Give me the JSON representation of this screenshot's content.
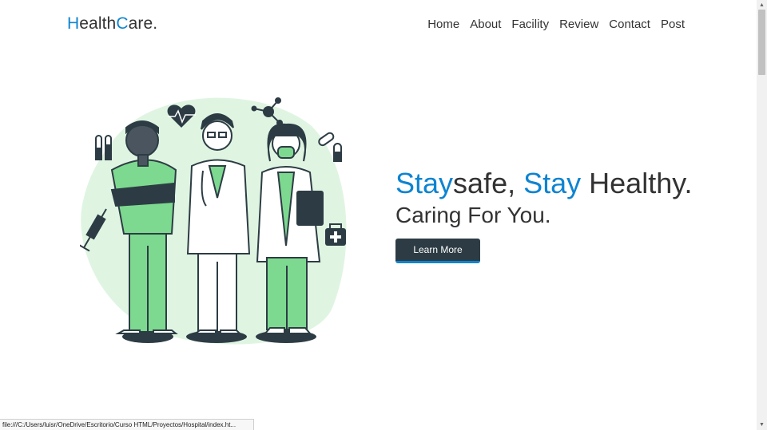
{
  "logo": {
    "part1": "H",
    "part2": "ealth",
    "part3": "C",
    "part4": "are."
  },
  "nav": {
    "items": [
      {
        "label": "Home"
      },
      {
        "label": "About"
      },
      {
        "label": "Facility"
      },
      {
        "label": "Review"
      },
      {
        "label": "Contact"
      },
      {
        "label": "Post"
      }
    ]
  },
  "hero": {
    "headline_accent1": "Stay",
    "headline_mid": "safe, ",
    "headline_accent2": "Stay",
    "headline_end": " Healthy.",
    "subline": "Caring For You.",
    "cta_label": "Learn More"
  },
  "statusbar": {
    "url": "file:///C:/Users/luisr/OneDrive/Escritorio/Curso HTML/Proyectos/Hospital/index.ht..."
  },
  "colors": {
    "accent": "#0e84d1",
    "text": "#333333",
    "button_bg": "#2d3c44",
    "illustration_green": "#7dd98f"
  }
}
